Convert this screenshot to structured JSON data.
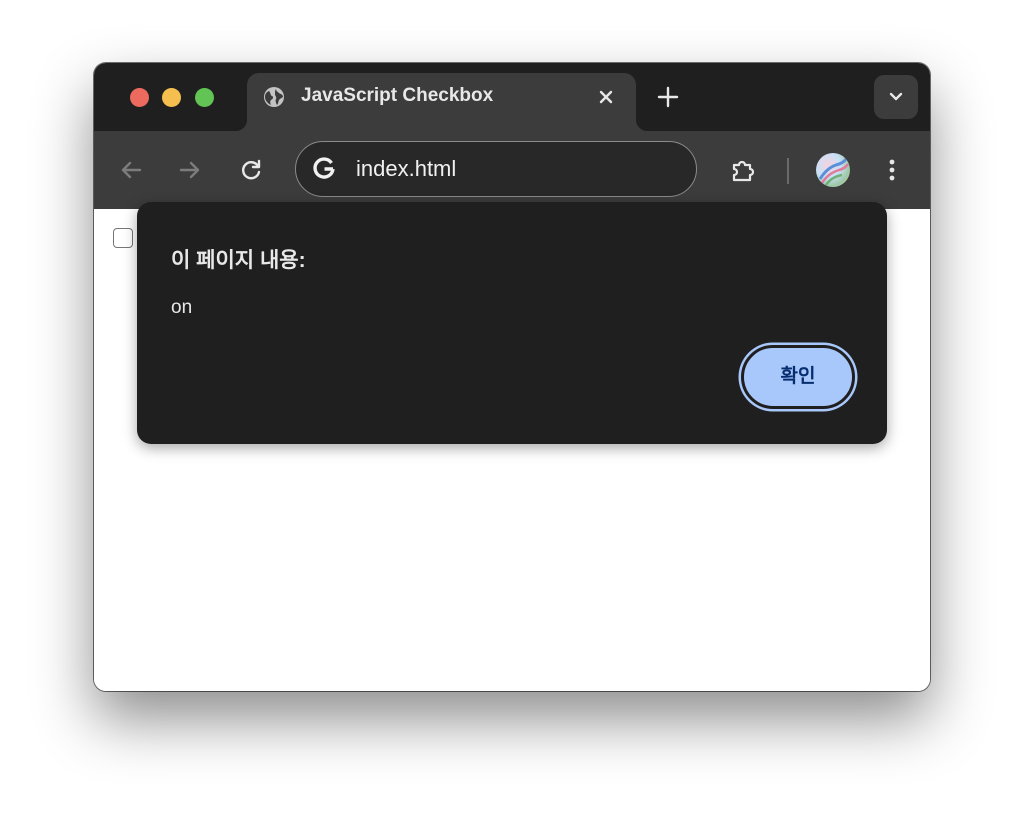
{
  "tab": {
    "title": "JavaScript Checkbox",
    "favicon_icon": "globe-icon",
    "close_icon": "close-icon"
  },
  "toolbar": {
    "new_tab_icon": "plus-icon",
    "tab_search_icon": "chevron-down-icon",
    "back_icon": "arrow-left-icon",
    "forward_icon": "arrow-right-icon",
    "reload_icon": "reload-icon",
    "omnibox_icon": "google-g-icon",
    "url": "index.html",
    "extensions_icon": "puzzle-icon",
    "menu_icon": "kebab-menu-icon"
  },
  "page": {
    "checkbox_checked": false
  },
  "dialog": {
    "title": "이 페이지 내용:",
    "message": "on",
    "ok_label": "확인"
  },
  "colors": {
    "titlebar": "#1f1f1f",
    "toolbar": "#3c3c3c",
    "dialog_bg": "#1f1f1f",
    "ok_button": "#a8c7fa",
    "ok_text": "#062e6f",
    "traffic_close": "#ed6a5e",
    "traffic_minimize": "#f4bf4f",
    "traffic_maximize": "#61c454"
  }
}
